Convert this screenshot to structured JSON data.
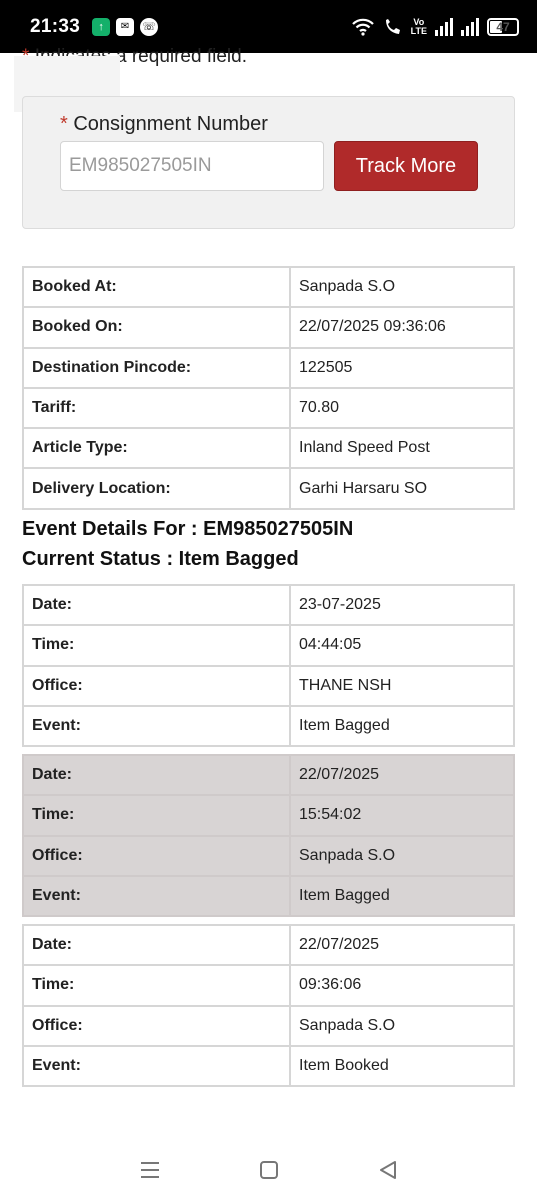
{
  "status_bar": {
    "time": "21:33",
    "volte_top": "Vo",
    "volte_bottom": "LTE",
    "battery": "47"
  },
  "form": {
    "required_note": "Indicates a required field.",
    "required_star": "*",
    "consignment_label": "Consignment Number",
    "consignment_value": "EM985027505IN",
    "track_button": "Track More"
  },
  "booking": [
    {
      "label": "Booked At:",
      "value": "Sanpada S.O"
    },
    {
      "label": "Booked On:",
      "value": "22/07/2025 09:36:06"
    },
    {
      "label": "Destination Pincode:",
      "value": "122505"
    },
    {
      "label": "Tariff:",
      "value": "70.80"
    },
    {
      "label": "Article Type:",
      "value": "Inland Speed Post"
    },
    {
      "label": "Delivery Location:",
      "value": "Garhi Harsaru SO"
    }
  ],
  "event_details_heading": "Event Details For : EM985027505IN",
  "current_status_heading": "Current Status : Item Bagged",
  "events": [
    [
      {
        "label": "Date:",
        "value": "23-07-2025"
      },
      {
        "label": "Time:",
        "value": "04:44:05"
      },
      {
        "label": "Office:",
        "value": "THANE NSH"
      },
      {
        "label": "Event:",
        "value": "Item Bagged"
      }
    ],
    [
      {
        "label": "Date:",
        "value": "22/07/2025"
      },
      {
        "label": "Time:",
        "value": "15:54:02"
      },
      {
        "label": "Office:",
        "value": "Sanpada S.O"
      },
      {
        "label": "Event:",
        "value": "Item Bagged"
      }
    ],
    [
      {
        "label": "Date:",
        "value": "22/07/2025"
      },
      {
        "label": "Time:",
        "value": "09:36:06"
      },
      {
        "label": "Office:",
        "value": "Sanpada S.O"
      },
      {
        "label": "Event:",
        "value": "Item Booked"
      }
    ]
  ],
  "icons": {
    "status_left": [
      "app-icon",
      "notification-icon",
      "call-icon"
    ],
    "status_right": [
      "wifi-icon",
      "wifi-call-icon",
      "signal-icon",
      "signal-icon",
      "battery-icon"
    ],
    "nav": [
      "recents-icon",
      "home-icon",
      "back-icon"
    ]
  },
  "colors": {
    "accent": "#b02a2a",
    "required_star": "#c0392b",
    "shaded_row": "#d8d4d4"
  }
}
